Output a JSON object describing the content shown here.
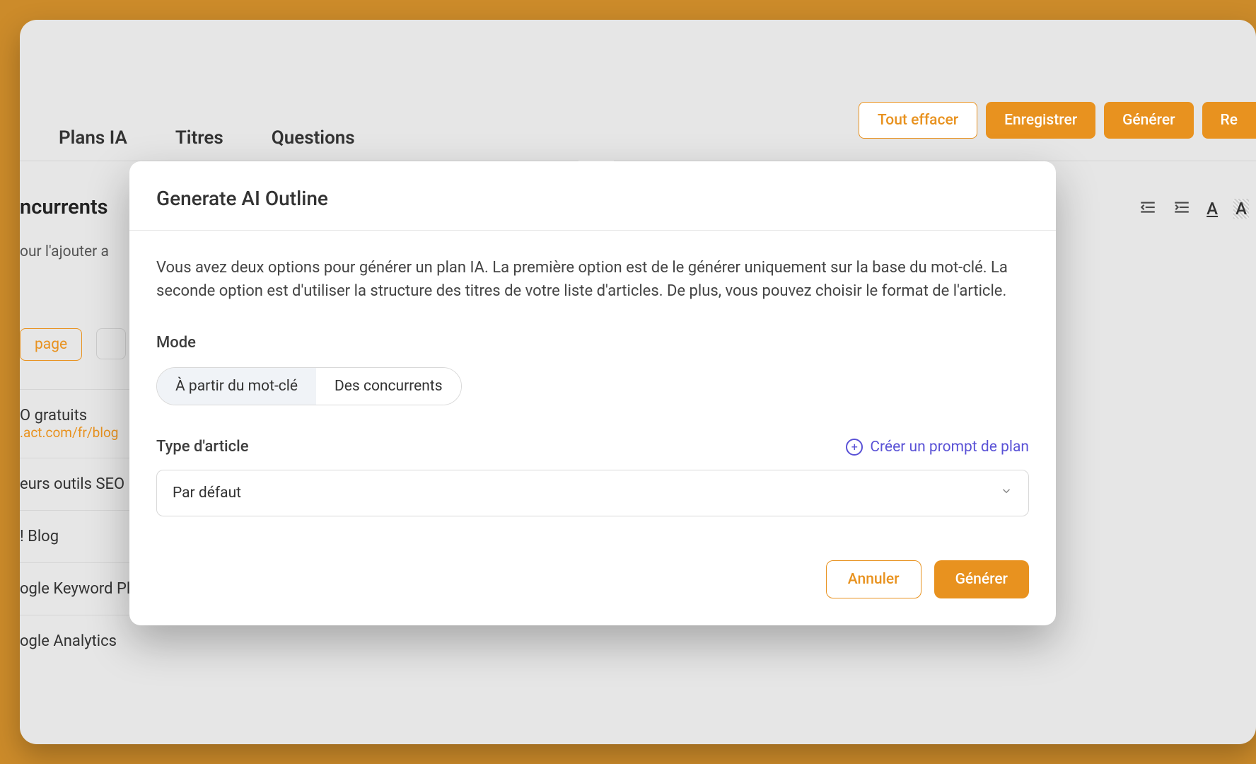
{
  "background": {
    "tabs": {
      "plans": "Plans IA",
      "titles": "Titres",
      "questions": "Questions"
    },
    "buttons": {
      "clear": "Tout effacer",
      "save": "Enregistrer",
      "generate": "Générer",
      "re": "Re"
    },
    "left": {
      "title_fragment": "ncurrents",
      "subtitle_fragment": "our l'ajouter a",
      "page_pill": "page",
      "items": {
        "item1a": "O gratuits",
        "item1b": ".act.com/fr/blog",
        "item2": "eurs outils SEO",
        "item3": "! Blog",
        "item4": "ogle Keyword Planner",
        "item5": "ogle Analytics"
      }
    }
  },
  "modal": {
    "title": "Generate AI Outline",
    "description": "Vous avez deux options pour générer un plan IA. La première option est de le générer uniquement sur la base du mot-clé. La seconde option est d'utiliser la structure des titres de votre liste d'articles. De plus, vous pouvez choisir le format de l'article.",
    "mode_label": "Mode",
    "mode_options": {
      "from_keyword": "À partir du mot-clé",
      "from_competitors": "Des concurrents"
    },
    "article_type_label": "Type d'article",
    "create_prompt": "Créer un prompt de plan",
    "select_value": "Par défaut",
    "cancel": "Annuler",
    "generate": "Générer"
  }
}
